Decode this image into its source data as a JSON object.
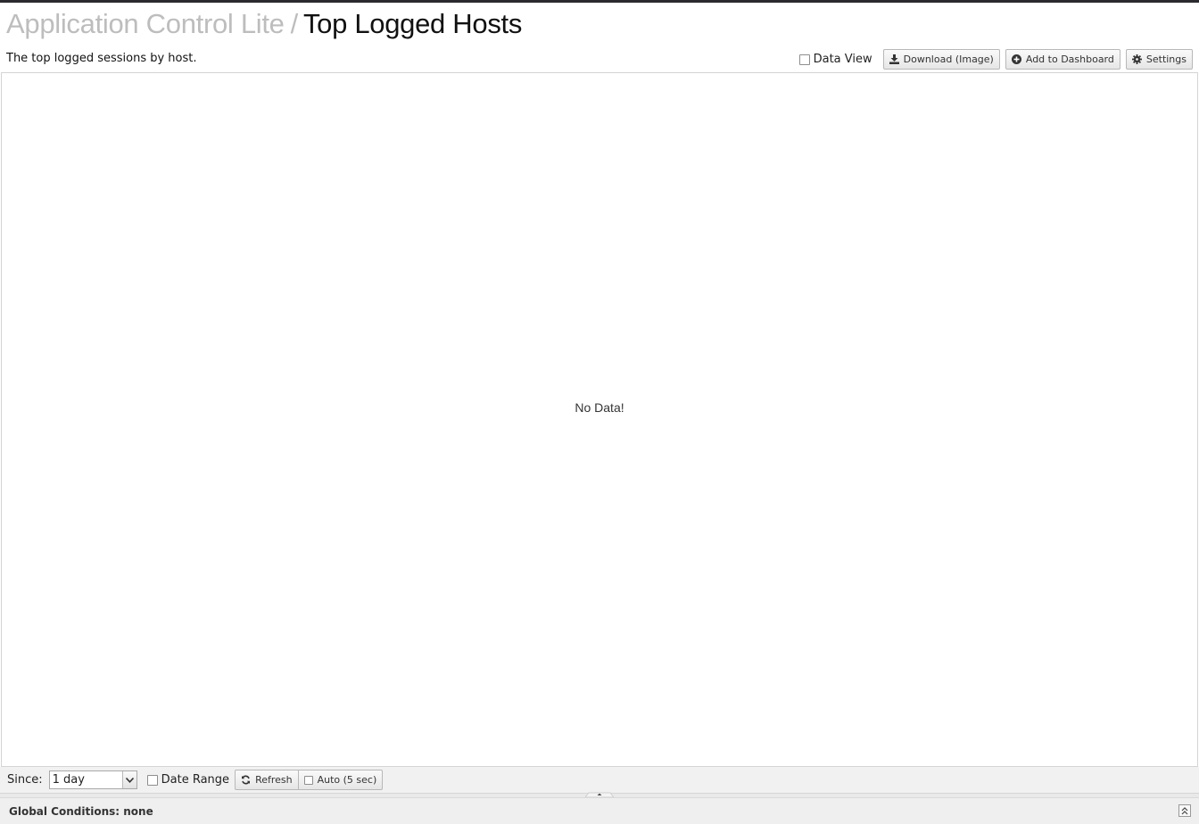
{
  "header": {
    "app_name": "Application Control Lite",
    "separator": "/",
    "report_title": "Top Logged Hosts",
    "description": "The top logged sessions by host."
  },
  "actions": {
    "data_view_label": "Data View",
    "data_view_checked": false,
    "download_label": "Download (Image)",
    "add_dashboard_label": "Add to Dashboard",
    "settings_label": "Settings"
  },
  "chart": {
    "no_data_text": "No Data!"
  },
  "toolbar": {
    "since_label": "Since:",
    "since_value": "1 day",
    "date_range_label": "Date Range",
    "date_range_checked": false,
    "refresh_label": "Refresh",
    "auto_label": "Auto (5 sec)",
    "auto_checked": false
  },
  "footer": {
    "global_conditions": "Global Conditions: none"
  },
  "icons": {
    "download": "download-icon",
    "add": "plus-circle-icon",
    "settings": "gear-icon",
    "refresh": "refresh-icon",
    "dropdown": "chevron-down-icon",
    "expand": "double-chevron-up-icon"
  },
  "colors": {
    "app_name": "#bdbdbd",
    "title": "#111111",
    "toolbar_bg": "#f1f1f1",
    "footer_bg": "#efefef"
  }
}
